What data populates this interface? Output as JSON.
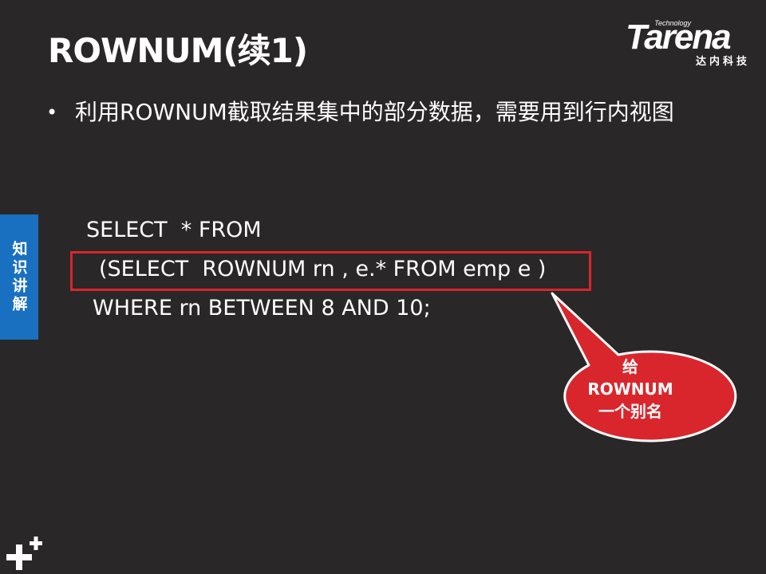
{
  "slide": {
    "title": "ROWNUM(续1)",
    "bullet": "利用ROWNUM截取结果集中的部分数据，需要用到行内视图",
    "side_tab": "知识讲解"
  },
  "logo": {
    "small": "Technology",
    "word": "Tarena",
    "sub": "达内科技"
  },
  "code": {
    "line1": "SELECT  * FROM",
    "line2": "(SELECT  ROWNUM rn , e.* FROM emp e )",
    "line3": "WHERE rn BETWEEN 8 AND 10;"
  },
  "callout": {
    "line1": "给",
    "line2": "ROWNUM",
    "line3": "一个别名"
  },
  "colors": {
    "background": "#2a2728",
    "accent_red": "#d9262c",
    "side_tab_blue": "#1a70c0"
  }
}
